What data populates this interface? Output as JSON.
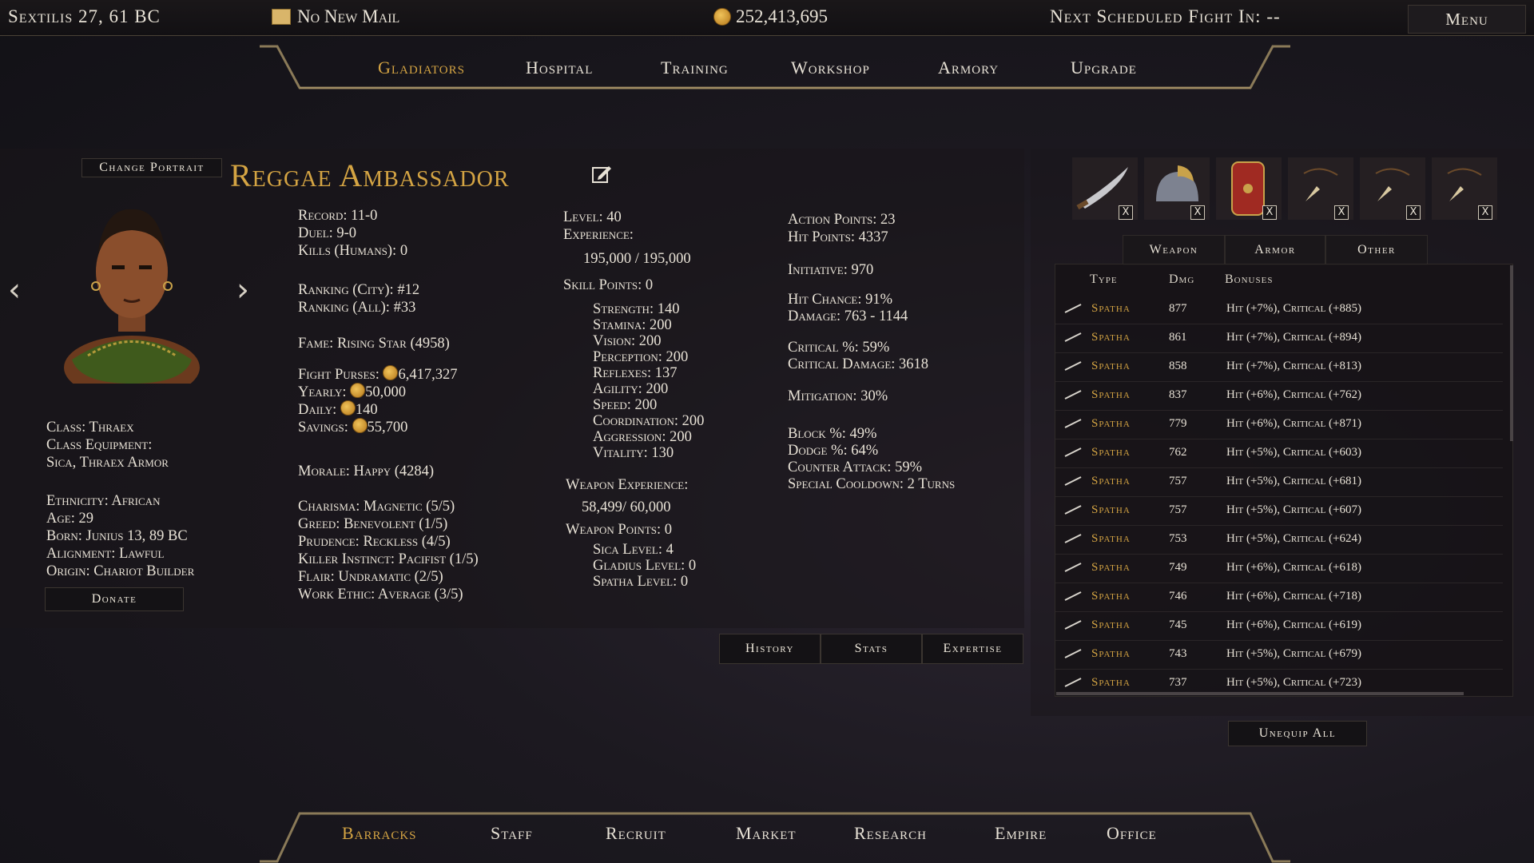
{
  "topbar": {
    "date": "Sextilis 27, 61 BC",
    "mail": "No New Mail",
    "money": "252,413,695",
    "next_fight": "Next Scheduled Fight In: --",
    "menu": "Menu"
  },
  "top_nav": [
    "Gladiators",
    "Hospital",
    "Training",
    "Workshop",
    "Armory",
    "Upgrade"
  ],
  "bottom_nav": [
    "Barracks",
    "Staff",
    "Recruit",
    "Market",
    "Research",
    "Empire",
    "Office"
  ],
  "gladiator": {
    "change_portrait": "Change Portrait",
    "name": "Reggae Ambassador",
    "info": {
      "class": "Class: Thraex",
      "class_equipment_label": "Class Equipment:",
      "class_equipment": "Sica, Thraex Armor",
      "ethnicity": "Ethnicity: African",
      "age": "Age: 29",
      "born": "Born: Junius 13, 89 BC",
      "alignment": "Alignment: Lawful",
      "origin": "Origin: Chariot Builder"
    },
    "donate": "Donate",
    "col1": {
      "record": "Record: 11-0",
      "duel": "Duel: 9-0",
      "kills": "Kills (Humans): 0",
      "ranking_city": "Ranking (City): #12",
      "ranking_all": "Ranking (All): #33",
      "fame": "Fame: Rising Star (4958)",
      "fight_purses_label": "Fight Purses:",
      "fight_purses": "6,417,327",
      "yearly_label": "Yearly:",
      "yearly": "50,000",
      "daily_label": "Daily:",
      "daily": "140",
      "savings_label": "Savings:",
      "savings": "55,700",
      "morale": "Morale: Happy (4284)",
      "charisma": "Charisma: Magnetic (5/5)",
      "greed": "Greed: Benevolent (1/5)",
      "prudence": "Prudence: Reckless (4/5)",
      "killer": "Killer Instinct: Pacifist (1/5)",
      "flair": "Flair: Undramatic (2/5)",
      "work": "Work Ethic: Average (3/5)"
    },
    "col2": {
      "level": "Level: 40",
      "experience_label": "Experience:",
      "experience": "195,000 / 195,000",
      "skill_points": "Skill Points: 0",
      "strength": "Strength: 140",
      "stamina": "Stamina: 200",
      "vision": "Vision: 200",
      "perception": "Perception: 200",
      "reflexes": "Reflexes: 137",
      "agility": "Agility: 200",
      "speed": "Speed: 200",
      "coordination": "Coordination: 200",
      "aggression": "Aggression: 200",
      "vitality": "Vitality: 130",
      "weapon_exp_label": "Weapon Experience:",
      "weapon_exp": "58,499/ 60,000",
      "weapon_points": "Weapon Points: 0",
      "sica": "Sica Level: 4",
      "gladius": "Gladius Level: 0",
      "spatha": "Spatha Level: 0"
    },
    "col3": {
      "action_points": "Action Points: 23",
      "hit_points": "Hit Points: 4337",
      "initiative": "Initiative: 970",
      "hit_chance": "Hit Chance: 91%",
      "damage": "Damage: 763 - 1144",
      "critical_pct": "Critical %: 59%",
      "critical_damage": "Critical Damage: 3618",
      "mitigation": "Mitigation: 30%",
      "block": "Block %: 49%",
      "dodge": "Dodge %: 64%",
      "counter": "Counter Attack: 59%",
      "special": "Special Cooldown: 2 Turns"
    },
    "tabs": [
      "History",
      "Stats",
      "Expertise"
    ]
  },
  "equipment": {
    "slots": [
      {
        "icon": "sword-icon"
      },
      {
        "icon": "helmet-icon"
      },
      {
        "icon": "shield-icon"
      },
      {
        "icon": "amulet-icon"
      },
      {
        "icon": "amulet-icon"
      },
      {
        "icon": "amulet-icon"
      }
    ],
    "remove_label": "X",
    "tabs": [
      "Weapon",
      "Armor",
      "Other"
    ],
    "table_headers": {
      "type": "Type",
      "dmg": "Dmg",
      "bonuses": "Bonuses"
    },
    "rows": [
      {
        "type": "Spatha",
        "dmg": "877",
        "bonuses": "Hit (+7%), Critical (+885)"
      },
      {
        "type": "Spatha",
        "dmg": "861",
        "bonuses": "Hit (+7%), Critical (+894)"
      },
      {
        "type": "Spatha",
        "dmg": "858",
        "bonuses": "Hit (+7%), Critical (+813)"
      },
      {
        "type": "Spatha",
        "dmg": "837",
        "bonuses": "Hit (+6%), Critical (+762)"
      },
      {
        "type": "Spatha",
        "dmg": "779",
        "bonuses": "Hit (+6%), Critical (+871)"
      },
      {
        "type": "Spatha",
        "dmg": "762",
        "bonuses": "Hit (+5%), Critical (+603)"
      },
      {
        "type": "Spatha",
        "dmg": "757",
        "bonuses": "Hit (+5%), Critical (+681)"
      },
      {
        "type": "Spatha",
        "dmg": "757",
        "bonuses": "Hit (+5%), Critical (+607)"
      },
      {
        "type": "Spatha",
        "dmg": "753",
        "bonuses": "Hit (+5%), Critical (+624)"
      },
      {
        "type": "Spatha",
        "dmg": "749",
        "bonuses": "Hit (+6%), Critical (+618)"
      },
      {
        "type": "Spatha",
        "dmg": "746",
        "bonuses": "Hit (+6%), Critical (+718)"
      },
      {
        "type": "Spatha",
        "dmg": "745",
        "bonuses": "Hit (+6%), Critical (+619)"
      },
      {
        "type": "Spatha",
        "dmg": "743",
        "bonuses": "Hit (+5%), Critical (+679)"
      },
      {
        "type": "Spatha",
        "dmg": "737",
        "bonuses": "Hit (+5%), Critical (+723)"
      }
    ],
    "unequip_all": "Unequip All"
  },
  "colors": {
    "accent": "#d4a443",
    "text": "#e8e2d6",
    "panel": "#1a161a"
  }
}
